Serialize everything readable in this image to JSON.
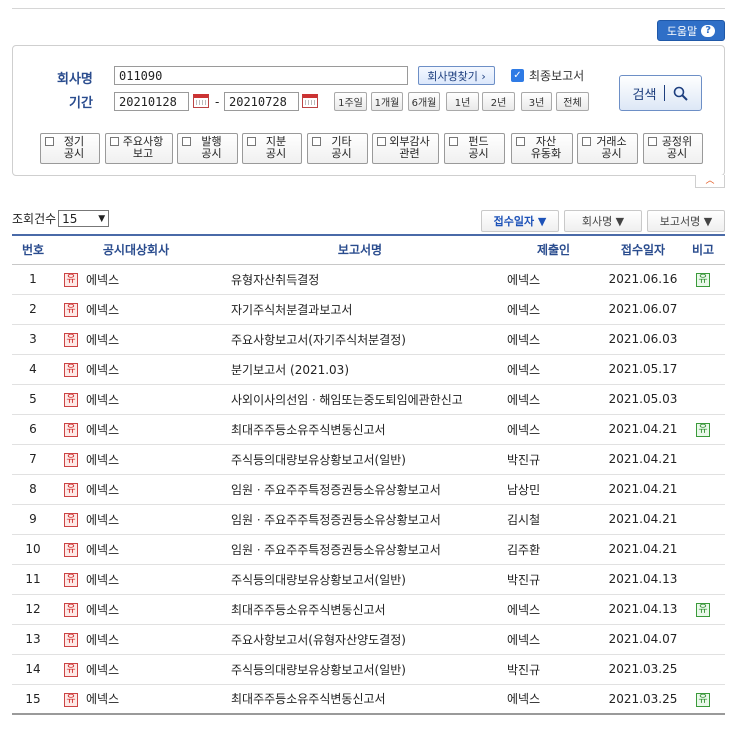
{
  "help_label": "도움말",
  "search": {
    "company_label": "회사명",
    "company_value": "011090",
    "find_company_button": "회사명찾기 ›",
    "final_report_label": "최종보고서",
    "final_report_checked": true,
    "period_label": "기간",
    "date_from": "20210128",
    "date_to": "20210728",
    "period_buttons": [
      "1주일",
      "1개월",
      "6개월",
      "1년",
      "2년",
      "3년",
      "전체"
    ],
    "search_button": "검색",
    "categories": [
      {
        "line1": "정기",
        "line2": "공시"
      },
      {
        "line1": "주요사항",
        "line2": "보고"
      },
      {
        "line1": "발행",
        "line2": "공시"
      },
      {
        "line1": "지분",
        "line2": "공시"
      },
      {
        "line1": "기타",
        "line2": "공시"
      },
      {
        "line1": "외부감사",
        "line2": "관련"
      },
      {
        "line1": "펀드",
        "line2": "공시"
      },
      {
        "line1": "자산",
        "line2": "유동화"
      },
      {
        "line1": "거래소",
        "line2": "공시"
      },
      {
        "line1": "공정위",
        "line2": "공시"
      }
    ]
  },
  "results": {
    "count_label": "조회건수",
    "count_value": "15",
    "sort_buttons": [
      "접수일자 ▼",
      "회사명 ▼",
      "보고서명 ▼"
    ],
    "columns": [
      "번호",
      "공시대상회사",
      "보고서명",
      "제출인",
      "접수일자",
      "비고"
    ],
    "market_badge": "유",
    "rows": [
      {
        "no": "1",
        "company": "에넥스",
        "report": "유형자산취득결정",
        "submitter": "에넥스",
        "date": "2021.06.16",
        "note": "유"
      },
      {
        "no": "2",
        "company": "에넥스",
        "report": "자기주식처분결과보고서",
        "submitter": "에넥스",
        "date": "2021.06.07",
        "note": ""
      },
      {
        "no": "3",
        "company": "에넥스",
        "report": "주요사항보고서(자기주식처분결정)",
        "submitter": "에넥스",
        "date": "2021.06.03",
        "note": ""
      },
      {
        "no": "4",
        "company": "에넥스",
        "report": "분기보고서 (2021.03)",
        "submitter": "에넥스",
        "date": "2021.05.17",
        "note": ""
      },
      {
        "no": "5",
        "company": "에넥스",
        "report": "사외이사의선임ㆍ해임또는중도퇴임에관한신고",
        "submitter": "에넥스",
        "date": "2021.05.03",
        "note": ""
      },
      {
        "no": "6",
        "company": "에넥스",
        "report": "최대주주등소유주식변동신고서",
        "submitter": "에넥스",
        "date": "2021.04.21",
        "note": "유"
      },
      {
        "no": "7",
        "company": "에넥스",
        "report": "주식등의대량보유상황보고서(일반)",
        "submitter": "박진규",
        "date": "2021.04.21",
        "note": ""
      },
      {
        "no": "8",
        "company": "에넥스",
        "report": "임원ㆍ주요주주특정증권등소유상황보고서",
        "submitter": "남상민",
        "date": "2021.04.21",
        "note": ""
      },
      {
        "no": "9",
        "company": "에넥스",
        "report": "임원ㆍ주요주주특정증권등소유상황보고서",
        "submitter": "김시철",
        "date": "2021.04.21",
        "note": ""
      },
      {
        "no": "10",
        "company": "에넥스",
        "report": "임원ㆍ주요주주특정증권등소유상황보고서",
        "submitter": "김주환",
        "date": "2021.04.21",
        "note": ""
      },
      {
        "no": "11",
        "company": "에넥스",
        "report": "주식등의대량보유상황보고서(일반)",
        "submitter": "박진규",
        "date": "2021.04.13",
        "note": ""
      },
      {
        "no": "12",
        "company": "에넥스",
        "report": "최대주주등소유주식변동신고서",
        "submitter": "에넥스",
        "date": "2021.04.13",
        "note": "유"
      },
      {
        "no": "13",
        "company": "에넥스",
        "report": "주요사항보고서(유형자산양도결정)",
        "submitter": "에넥스",
        "date": "2021.04.07",
        "note": ""
      },
      {
        "no": "14",
        "company": "에넥스",
        "report": "주식등의대량보유상황보고서(일반)",
        "submitter": "박진규",
        "date": "2021.03.25",
        "note": ""
      },
      {
        "no": "15",
        "company": "에넥스",
        "report": "최대주주등소유주식변동신고서",
        "submitter": "에넥스",
        "date": "2021.03.25",
        "note": "유"
      }
    ]
  }
}
